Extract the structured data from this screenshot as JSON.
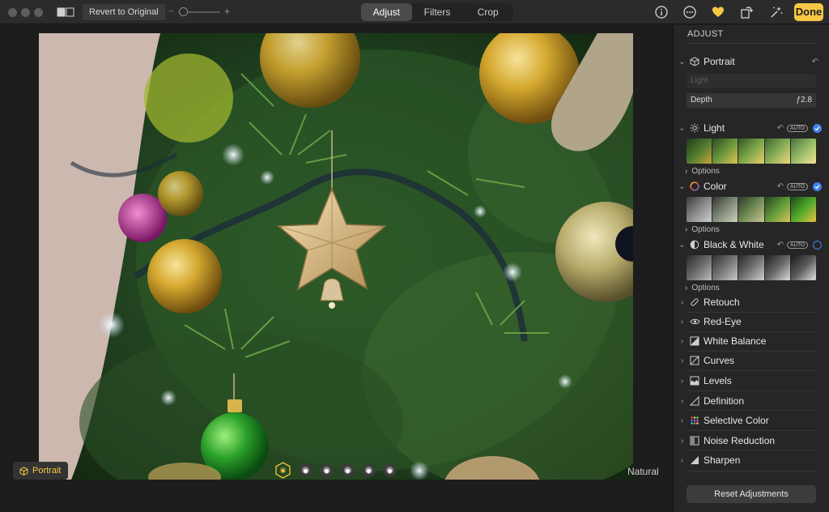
{
  "toolbar": {
    "revert_label": "Revert to Original",
    "zoom_minus": "−",
    "zoom_plus": "+",
    "tabs": [
      {
        "label": "Adjust",
        "active": true
      },
      {
        "label": "Filters",
        "active": false
      },
      {
        "label": "Crop",
        "active": false
      }
    ],
    "done_label": "Done",
    "icons": [
      "info-icon",
      "more-icon",
      "favorite-heart-icon",
      "rotate-icon",
      "auto-enhance-icon"
    ],
    "accent": "#f6c744"
  },
  "bottom": {
    "portrait_label": "Portrait",
    "lighting_effect": "Natural"
  },
  "sidebar": {
    "title": "ADJUST",
    "portrait": {
      "label": "Portrait",
      "light_placeholder": "Light",
      "depth_label": "Depth",
      "depth_value": "ƒ2.8"
    },
    "light": {
      "label": "Light",
      "auto": "AUTO",
      "enabled": true,
      "options": "Options"
    },
    "color": {
      "label": "Color",
      "auto": "AUTO",
      "enabled": true,
      "options": "Options"
    },
    "bw": {
      "label": "Black & White",
      "auto": "AUTO",
      "enabled": false,
      "options": "Options"
    },
    "tools": [
      {
        "label": "Retouch",
        "icon": "bandage-icon"
      },
      {
        "label": "Red-Eye",
        "icon": "eye-icon"
      },
      {
        "label": "White Balance",
        "icon": "white-balance-icon"
      },
      {
        "label": "Curves",
        "icon": "curves-icon"
      },
      {
        "label": "Levels",
        "icon": "levels-icon"
      },
      {
        "label": "Definition",
        "icon": "definition-icon"
      },
      {
        "label": "Selective Color",
        "icon": "selective-color-icon"
      },
      {
        "label": "Noise Reduction",
        "icon": "noise-reduction-icon"
      },
      {
        "label": "Sharpen",
        "icon": "sharpen-icon"
      }
    ],
    "reset_label": "Reset Adjustments",
    "check_color": "#3b82f6"
  }
}
